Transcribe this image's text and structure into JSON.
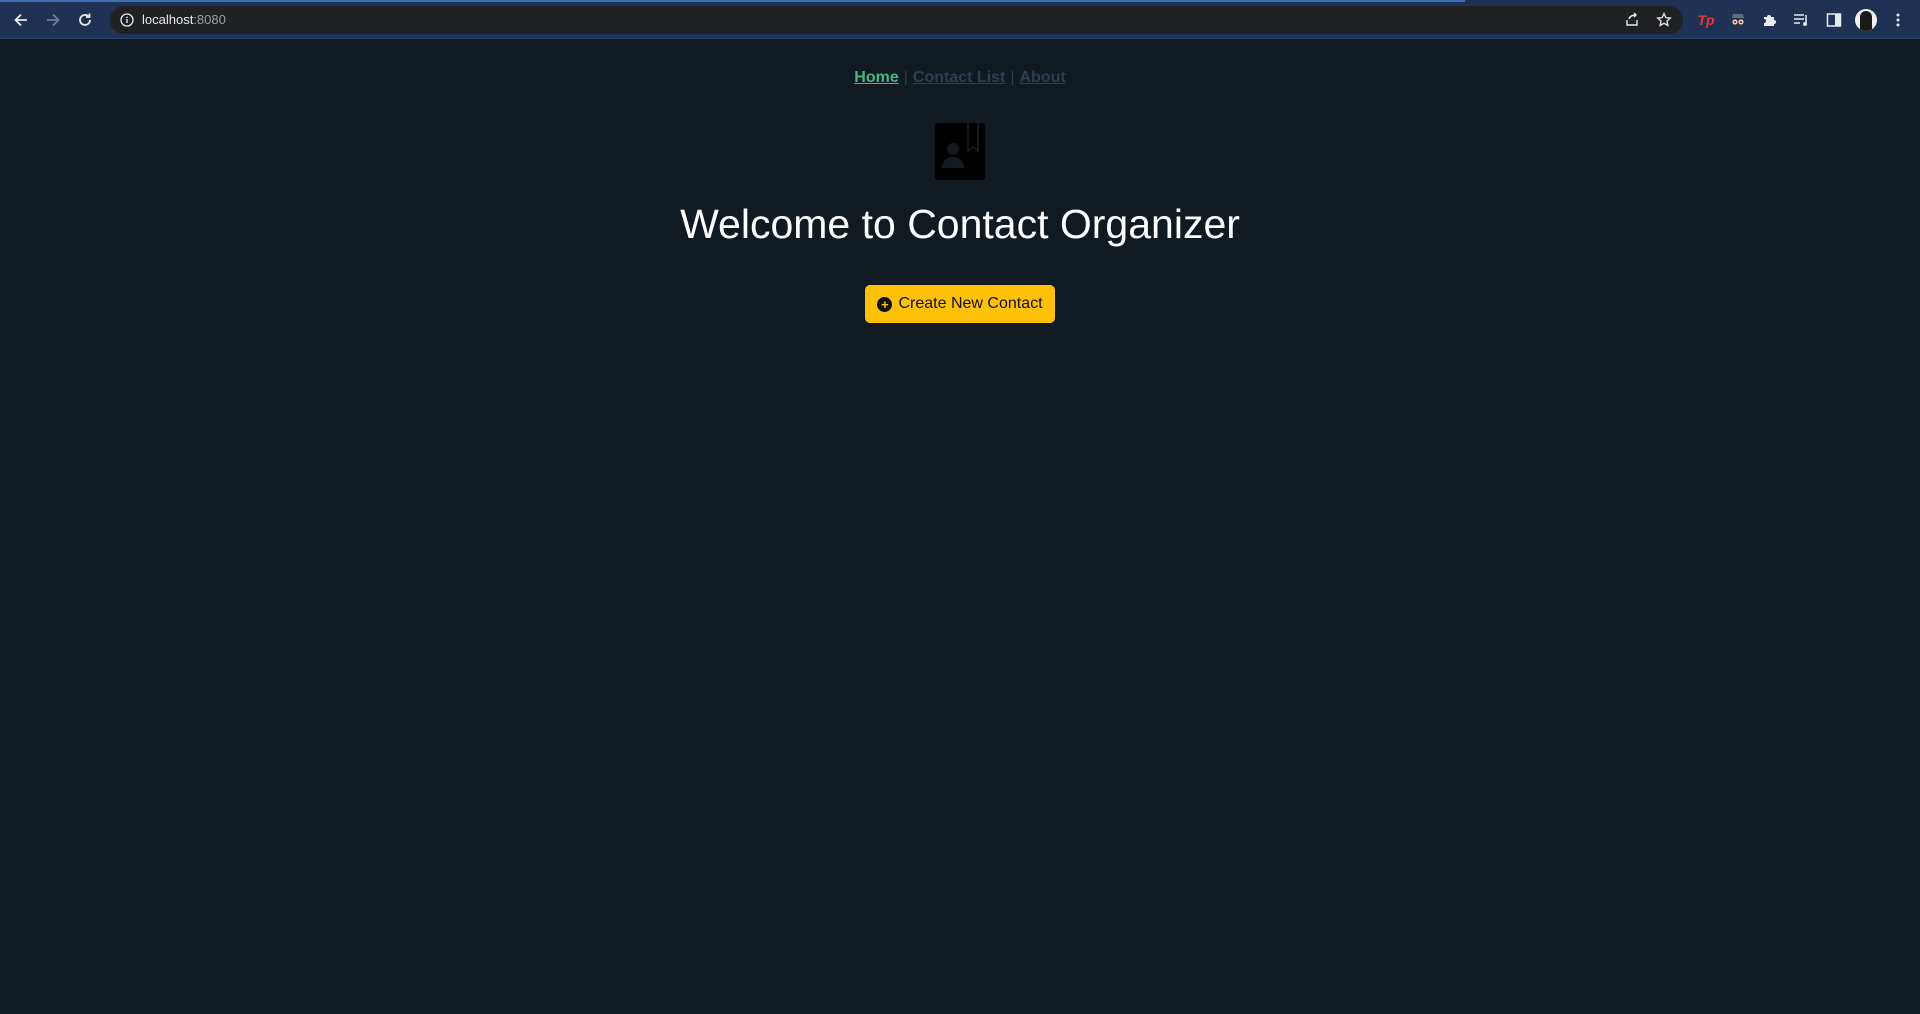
{
  "browser": {
    "url_host": "localhost",
    "url_port": ":8080",
    "extensions": [
      "tp-extension-icon",
      "spy-extension-icon",
      "puzzle-icon",
      "media-control-icon",
      "side-panel-icon"
    ]
  },
  "nav": {
    "items": [
      {
        "label": "Home",
        "active": true
      },
      {
        "label": "Contact List",
        "active": false
      },
      {
        "label": "About",
        "active": false
      }
    ],
    "separator": "|"
  },
  "main": {
    "heading": "Welcome to Contact Organizer",
    "create_button_label": "Create New Contact"
  },
  "colors": {
    "background": "#101a20",
    "active_link": "#42b983",
    "inactive_link": "#2c3e50",
    "button": "#ffc107"
  }
}
